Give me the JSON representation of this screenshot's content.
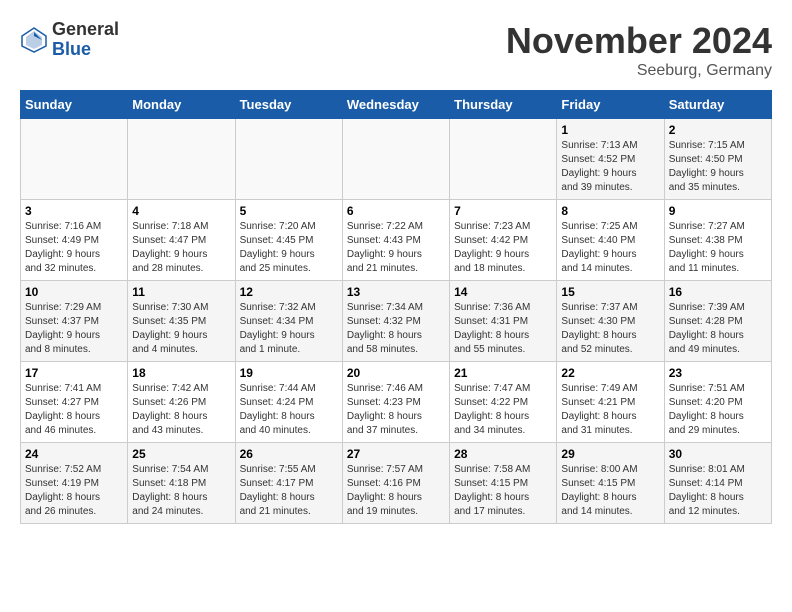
{
  "header": {
    "logo_general": "General",
    "logo_blue": "Blue",
    "month_title": "November 2024",
    "location": "Seeburg, Germany"
  },
  "weekdays": [
    "Sunday",
    "Monday",
    "Tuesday",
    "Wednesday",
    "Thursday",
    "Friday",
    "Saturday"
  ],
  "weeks": [
    [
      {
        "day": "",
        "info": ""
      },
      {
        "day": "",
        "info": ""
      },
      {
        "day": "",
        "info": ""
      },
      {
        "day": "",
        "info": ""
      },
      {
        "day": "",
        "info": ""
      },
      {
        "day": "1",
        "info": "Sunrise: 7:13 AM\nSunset: 4:52 PM\nDaylight: 9 hours\nand 39 minutes."
      },
      {
        "day": "2",
        "info": "Sunrise: 7:15 AM\nSunset: 4:50 PM\nDaylight: 9 hours\nand 35 minutes."
      }
    ],
    [
      {
        "day": "3",
        "info": "Sunrise: 7:16 AM\nSunset: 4:49 PM\nDaylight: 9 hours\nand 32 minutes."
      },
      {
        "day": "4",
        "info": "Sunrise: 7:18 AM\nSunset: 4:47 PM\nDaylight: 9 hours\nand 28 minutes."
      },
      {
        "day": "5",
        "info": "Sunrise: 7:20 AM\nSunset: 4:45 PM\nDaylight: 9 hours\nand 25 minutes."
      },
      {
        "day": "6",
        "info": "Sunrise: 7:22 AM\nSunset: 4:43 PM\nDaylight: 9 hours\nand 21 minutes."
      },
      {
        "day": "7",
        "info": "Sunrise: 7:23 AM\nSunset: 4:42 PM\nDaylight: 9 hours\nand 18 minutes."
      },
      {
        "day": "8",
        "info": "Sunrise: 7:25 AM\nSunset: 4:40 PM\nDaylight: 9 hours\nand 14 minutes."
      },
      {
        "day": "9",
        "info": "Sunrise: 7:27 AM\nSunset: 4:38 PM\nDaylight: 9 hours\nand 11 minutes."
      }
    ],
    [
      {
        "day": "10",
        "info": "Sunrise: 7:29 AM\nSunset: 4:37 PM\nDaylight: 9 hours\nand 8 minutes."
      },
      {
        "day": "11",
        "info": "Sunrise: 7:30 AM\nSunset: 4:35 PM\nDaylight: 9 hours\nand 4 minutes."
      },
      {
        "day": "12",
        "info": "Sunrise: 7:32 AM\nSunset: 4:34 PM\nDaylight: 9 hours\nand 1 minute."
      },
      {
        "day": "13",
        "info": "Sunrise: 7:34 AM\nSunset: 4:32 PM\nDaylight: 8 hours\nand 58 minutes."
      },
      {
        "day": "14",
        "info": "Sunrise: 7:36 AM\nSunset: 4:31 PM\nDaylight: 8 hours\nand 55 minutes."
      },
      {
        "day": "15",
        "info": "Sunrise: 7:37 AM\nSunset: 4:30 PM\nDaylight: 8 hours\nand 52 minutes."
      },
      {
        "day": "16",
        "info": "Sunrise: 7:39 AM\nSunset: 4:28 PM\nDaylight: 8 hours\nand 49 minutes."
      }
    ],
    [
      {
        "day": "17",
        "info": "Sunrise: 7:41 AM\nSunset: 4:27 PM\nDaylight: 8 hours\nand 46 minutes."
      },
      {
        "day": "18",
        "info": "Sunrise: 7:42 AM\nSunset: 4:26 PM\nDaylight: 8 hours\nand 43 minutes."
      },
      {
        "day": "19",
        "info": "Sunrise: 7:44 AM\nSunset: 4:24 PM\nDaylight: 8 hours\nand 40 minutes."
      },
      {
        "day": "20",
        "info": "Sunrise: 7:46 AM\nSunset: 4:23 PM\nDaylight: 8 hours\nand 37 minutes."
      },
      {
        "day": "21",
        "info": "Sunrise: 7:47 AM\nSunset: 4:22 PM\nDaylight: 8 hours\nand 34 minutes."
      },
      {
        "day": "22",
        "info": "Sunrise: 7:49 AM\nSunset: 4:21 PM\nDaylight: 8 hours\nand 31 minutes."
      },
      {
        "day": "23",
        "info": "Sunrise: 7:51 AM\nSunset: 4:20 PM\nDaylight: 8 hours\nand 29 minutes."
      }
    ],
    [
      {
        "day": "24",
        "info": "Sunrise: 7:52 AM\nSunset: 4:19 PM\nDaylight: 8 hours\nand 26 minutes."
      },
      {
        "day": "25",
        "info": "Sunrise: 7:54 AM\nSunset: 4:18 PM\nDaylight: 8 hours\nand 24 minutes."
      },
      {
        "day": "26",
        "info": "Sunrise: 7:55 AM\nSunset: 4:17 PM\nDaylight: 8 hours\nand 21 minutes."
      },
      {
        "day": "27",
        "info": "Sunrise: 7:57 AM\nSunset: 4:16 PM\nDaylight: 8 hours\nand 19 minutes."
      },
      {
        "day": "28",
        "info": "Sunrise: 7:58 AM\nSunset: 4:15 PM\nDaylight: 8 hours\nand 17 minutes."
      },
      {
        "day": "29",
        "info": "Sunrise: 8:00 AM\nSunset: 4:15 PM\nDaylight: 8 hours\nand 14 minutes."
      },
      {
        "day": "30",
        "info": "Sunrise: 8:01 AM\nSunset: 4:14 PM\nDaylight: 8 hours\nand 12 minutes."
      }
    ]
  ]
}
